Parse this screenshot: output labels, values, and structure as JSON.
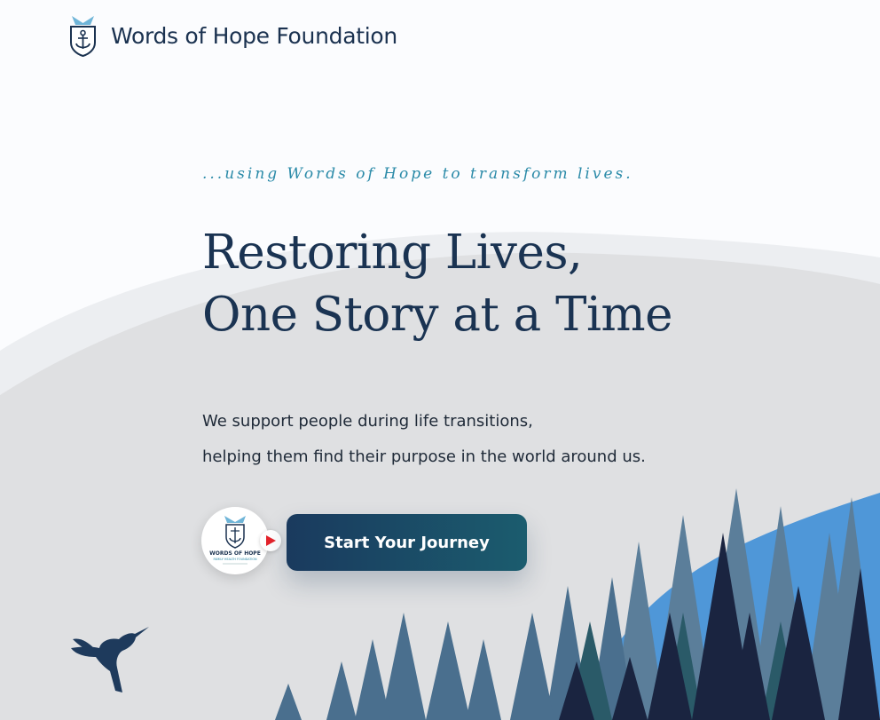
{
  "header": {
    "brand_name": "Words of Hope Foundation",
    "logo_icon": "anchor-shield-logo-icon"
  },
  "hero": {
    "tagline": "...using Words of Hope to transform lives.",
    "headline_line1": "Restoring Lives,",
    "headline_line2": "One Story at a Time",
    "subtext_line1": "We support people during life transitions,",
    "subtext_line2": "helping them find their purpose in the world around us.",
    "cta_label": "Start Your Journey",
    "video_badge": {
      "title": "WORDS OF HOPE",
      "subtitle": "FAMILY HEALTH FOUNDATION",
      "play_icon": "play-icon"
    }
  },
  "decor": {
    "bird_icon": "hummingbird-icon",
    "forest_icon": "pine-forest-illustration"
  },
  "colors": {
    "brand_navy": "#1a3352",
    "tagline_teal": "#2a8aa8",
    "cta_start": "#1a3a5e",
    "cta_end": "#1b5c6e",
    "play_red": "#e5222a",
    "accent_blue": "#4a90d0"
  }
}
